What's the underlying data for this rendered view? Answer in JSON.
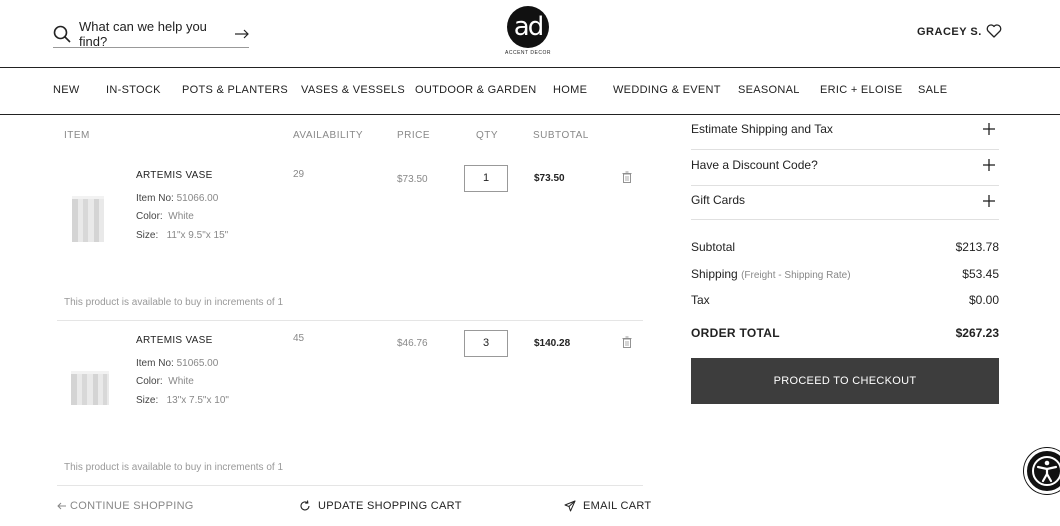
{
  "header": {
    "search_placeholder": "What can we help you find?",
    "logo_text": "ad",
    "logo_subtitle": "ACCENT DECOR",
    "user_name": "GRACEY S."
  },
  "nav": {
    "items": [
      "NEW",
      "IN-STOCK",
      "POTS & PLANTERS",
      "VASES & VESSELS",
      "OUTDOOR & GARDEN",
      "HOME",
      "WEDDING & EVENT",
      "SEASONAL",
      "ERIC + ELOISE",
      "SALE"
    ]
  },
  "cart": {
    "columns": {
      "item": "ITEM",
      "availability": "AVAILABILITY",
      "price": "PRICE",
      "qty": "QTY",
      "subtotal": "SUBTOTAL"
    },
    "labels": {
      "item_no": "Item No:",
      "color": "Color:",
      "size": "Size:"
    },
    "items": [
      {
        "name": "ARTEMIS VASE",
        "item_no": "51066.00",
        "color": "White",
        "size": "11\"x 9.5\"x 15\"",
        "availability": "29",
        "price": "$73.50",
        "qty": "1",
        "subtotal": "$73.50",
        "increment_note": "This product is available to buy in increments of 1"
      },
      {
        "name": "ARTEMIS VASE",
        "item_no": "51065.00",
        "color": "White",
        "size": "13\"x 7.5\"x 10\"",
        "availability": "45",
        "price": "$46.76",
        "qty": "3",
        "subtotal": "$140.28",
        "increment_note": "This product is available to buy in increments of 1"
      }
    ],
    "continue_shopping": "CONTINUE SHOPPING",
    "update_cart": "UPDATE SHOPPING CART",
    "email_cart": "EMAIL CART"
  },
  "summary": {
    "accordions": [
      "Estimate Shipping and Tax",
      "Have a Discount Code?",
      "Gift Cards"
    ],
    "subtotal_label": "Subtotal",
    "subtotal_value": "$213.78",
    "shipping_label": "Shipping",
    "shipping_sub": "(Freight - Shipping Rate)",
    "shipping_value": "$53.45",
    "tax_label": "Tax",
    "tax_value": "$0.00",
    "total_label": "ORDER TOTAL",
    "total_value": "$267.23",
    "checkout_label": "PROCEED TO CHECKOUT"
  },
  "colors": {
    "checkout_bg": "#3d3d3d",
    "text": "#222222",
    "muted": "#888888"
  }
}
